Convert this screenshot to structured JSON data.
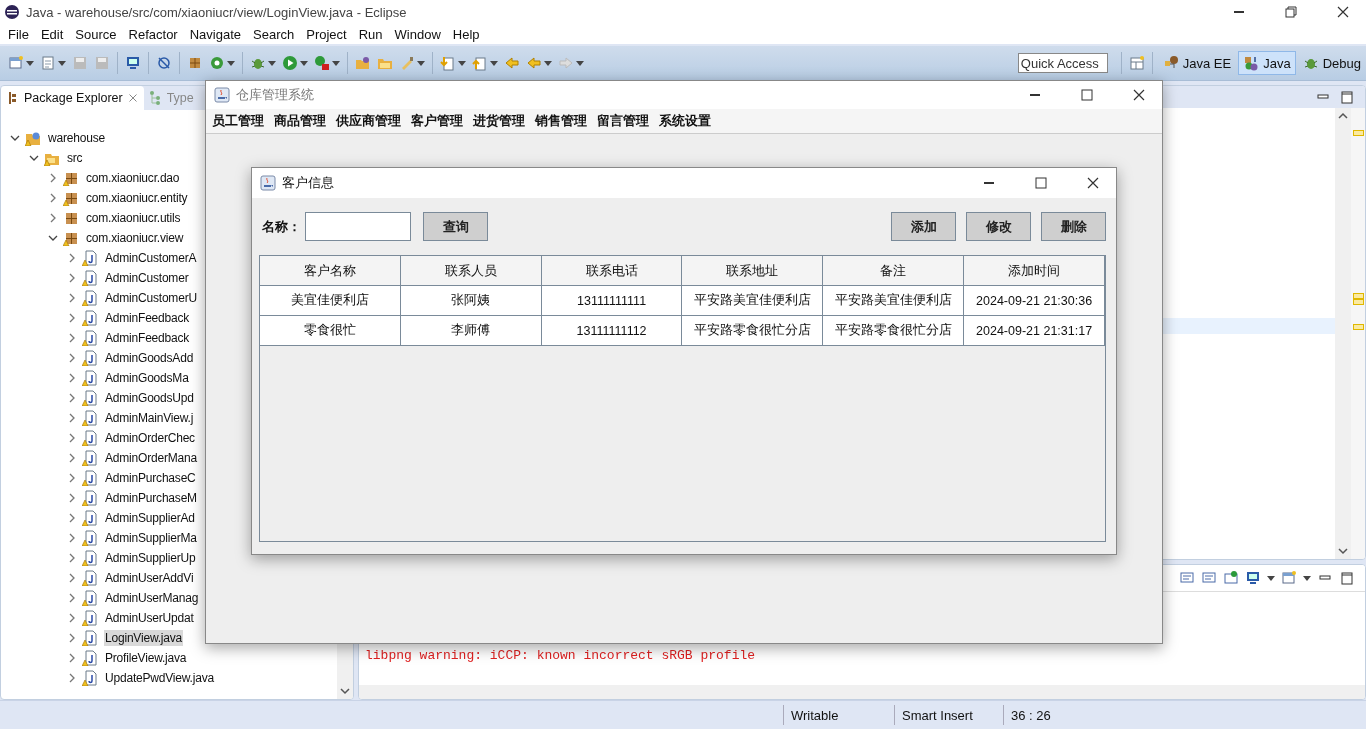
{
  "window": {
    "title": "Java - warehouse/src/com/xiaoniucr/view/LoginView.java - Eclipse"
  },
  "menu": [
    "File",
    "Edit",
    "Source",
    "Refactor",
    "Navigate",
    "Search",
    "Project",
    "Run",
    "Window",
    "Help"
  ],
  "quick_access": {
    "placeholder": "Quick Access"
  },
  "perspectives": [
    {
      "label": "Java EE",
      "selected": false
    },
    {
      "label": "Java",
      "selected": true
    },
    {
      "label": "Debug",
      "selected": false
    }
  ],
  "package_explorer": {
    "tabs": [
      {
        "label": "Package Explorer",
        "selected": true
      },
      {
        "label": "Type",
        "selected": false
      }
    ],
    "tree": [
      {
        "label": "warehouse",
        "kind": "project",
        "warning": true,
        "expanded": true,
        "selected": false,
        "children": [
          {
            "label": "src",
            "kind": "folder",
            "warning": true,
            "expanded": true,
            "selected": false,
            "children": [
              {
                "label": "com.xiaoniucr.dao",
                "kind": "package",
                "warning": true,
                "expanded": false,
                "selected": false
              },
              {
                "label": "com.xiaoniucr.entity",
                "kind": "package",
                "warning": true,
                "expanded": false,
                "selected": false
              },
              {
                "label": "com.xiaoniucr.utils",
                "kind": "package",
                "warning": false,
                "expanded": false,
                "selected": false
              },
              {
                "label": "com.xiaoniucr.view",
                "kind": "package",
                "warning": true,
                "expanded": true,
                "selected": false,
                "children": [
                  {
                    "label": "AdminCustomerA",
                    "kind": "file",
                    "warning": true,
                    "expanded": false,
                    "selected": false
                  },
                  {
                    "label": "AdminCustomer",
                    "kind": "file",
                    "warning": true,
                    "expanded": false,
                    "selected": false
                  },
                  {
                    "label": "AdminCustomerU",
                    "kind": "file",
                    "warning": true,
                    "expanded": false,
                    "selected": false
                  },
                  {
                    "label": "AdminFeedback",
                    "kind": "file",
                    "warning": true,
                    "expanded": false,
                    "selected": false
                  },
                  {
                    "label": "AdminFeedback",
                    "kind": "file",
                    "warning": true,
                    "expanded": false,
                    "selected": false
                  },
                  {
                    "label": "AdminGoodsAdd",
                    "kind": "file",
                    "warning": true,
                    "expanded": false,
                    "selected": false
                  },
                  {
                    "label": "AdminGoodsMa",
                    "kind": "file",
                    "warning": true,
                    "expanded": false,
                    "selected": false
                  },
                  {
                    "label": "AdminGoodsUpd",
                    "kind": "file",
                    "warning": true,
                    "expanded": false,
                    "selected": false
                  },
                  {
                    "label": "AdminMainView.j",
                    "kind": "file",
                    "warning": true,
                    "expanded": false,
                    "selected": false
                  },
                  {
                    "label": "AdminOrderChec",
                    "kind": "file",
                    "warning": true,
                    "expanded": false,
                    "selected": false
                  },
                  {
                    "label": "AdminOrderMana",
                    "kind": "file",
                    "warning": true,
                    "expanded": false,
                    "selected": false
                  },
                  {
                    "label": "AdminPurchaseC",
                    "kind": "file",
                    "warning": true,
                    "expanded": false,
                    "selected": false
                  },
                  {
                    "label": "AdminPurchaseM",
                    "kind": "file",
                    "warning": true,
                    "expanded": false,
                    "selected": false
                  },
                  {
                    "label": "AdminSupplierAd",
                    "kind": "file",
                    "warning": true,
                    "expanded": false,
                    "selected": false
                  },
                  {
                    "label": "AdminSupplierMa",
                    "kind": "file",
                    "warning": true,
                    "expanded": false,
                    "selected": false
                  },
                  {
                    "label": "AdminSupplierUp",
                    "kind": "file",
                    "warning": true,
                    "expanded": false,
                    "selected": false
                  },
                  {
                    "label": "AdminUserAddVi",
                    "kind": "file",
                    "warning": true,
                    "expanded": false,
                    "selected": false
                  },
                  {
                    "label": "AdminUserManag",
                    "kind": "file",
                    "warning": true,
                    "expanded": false,
                    "selected": false
                  },
                  {
                    "label": "AdminUserUpdat",
                    "kind": "file",
                    "warning": true,
                    "expanded": false,
                    "selected": false
                  },
                  {
                    "label": "LoginView.java",
                    "kind": "file",
                    "warning": true,
                    "expanded": false,
                    "selected": true
                  },
                  {
                    "label": "ProfileView.java",
                    "kind": "file",
                    "warning": true,
                    "expanded": false,
                    "selected": false
                  },
                  {
                    "label": "UpdatePwdView.java",
                    "kind": "file",
                    "warning": true,
                    "expanded": false,
                    "selected": false
                  }
                ]
              }
            ]
          }
        ]
      }
    ]
  },
  "console": {
    "lines": [
      "libpng warning: iCCP: known incorrect sRGB profile"
    ]
  },
  "status_bar": [
    "Writable",
    "Smart Insert",
    "36 : 26"
  ],
  "app_window": {
    "title": "仓库管理系统",
    "menu": [
      "员工管理",
      "商品管理",
      "供应商管理",
      "客户管理",
      "进货管理",
      "销售管理",
      "留言管理",
      "系统设置"
    ]
  },
  "dialog": {
    "title": "客户信息",
    "search_label": "名称：",
    "search_button": "查询",
    "buttons": [
      "添加",
      "修改",
      "删除"
    ],
    "table": {
      "columns": [
        "客户名称",
        "联系人员",
        "联系电话",
        "联系地址",
        "备注",
        "添加时间"
      ],
      "rows": [
        [
          "美宜佳便利店",
          "张阿姨",
          "13111111111",
          "平安路美宜佳便利店",
          "平安路美宜佳便利店",
          "2024-09-21 21:30:36"
        ],
        [
          "零食很忙",
          "李师傅",
          "13111111112",
          "平安路零食很忙分店",
          "平安路零食很忙分店",
          "2024-09-21 21:31:17"
        ]
      ]
    }
  }
}
